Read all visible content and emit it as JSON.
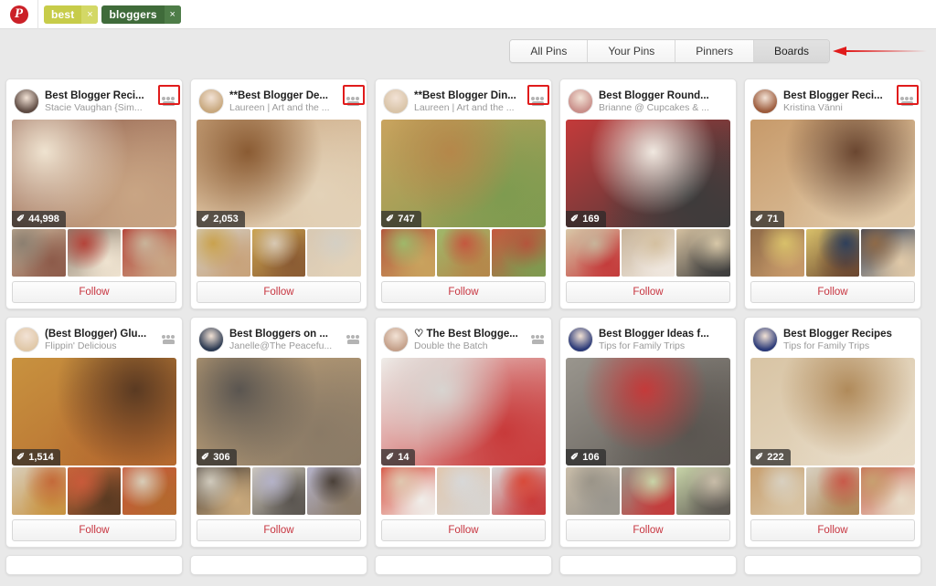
{
  "topbar": {
    "logo_icon": "pinterest-logo-icon",
    "search_tokens": [
      {
        "label": "best",
        "color": "#c7cc49",
        "remove_icon": "close-icon"
      },
      {
        "label": "bloggers",
        "color": "#3f6b3a",
        "remove_icon": "close-icon"
      }
    ]
  },
  "tabs": {
    "items": [
      {
        "label": "All Pins",
        "active": false
      },
      {
        "label": "Your Pins",
        "active": false
      },
      {
        "label": "Pinners",
        "active": false
      },
      {
        "label": "Boards",
        "active": true
      }
    ],
    "annotation_arrow_color": "#e01b1b",
    "annotation_arrow_icon": "arrow-left-icon"
  },
  "follow_label": "Follow",
  "pin_glyph": "✐",
  "highlight_color": "#e01b1b",
  "boards": [
    {
      "title": "Best Blogger Reci...",
      "owner": "Stacie Vaughan {Sim...",
      "pins": "44,998",
      "group_board": true,
      "highlighted": true,
      "avatar_color": "#5d4a42",
      "hero_colors": [
        "#8d5b4a",
        "#efe3d0",
        "#c9a584"
      ],
      "thumb_colors": [
        "#c9b49a",
        "#8c7f70",
        "#b5443a"
      ]
    },
    {
      "title": "**Best Blogger De...",
      "owner": "Laureen | Art and the ...",
      "pins": "2,053",
      "group_board": true,
      "highlighted": true,
      "avatar_color": "#c8a87e",
      "hero_colors": [
        "#c8a27a",
        "#8a5b33",
        "#e3d2b8"
      ],
      "thumb_colors": [
        "#d4cfc4",
        "#caa24e",
        "#d8c9b4"
      ]
    },
    {
      "title": "**Best Blogger Din...",
      "owner": "Laureen | Art and the ...",
      "pins": "747",
      "group_board": true,
      "highlighted": true,
      "avatar_color": "#d9c4a8",
      "hero_colors": [
        "#c9a35e",
        "#b5874a",
        "#7e9b50"
      ],
      "thumb_colors": [
        "#b4553c",
        "#9fb86a",
        "#c4583f"
      ]
    },
    {
      "title": "Best Blogger Round...",
      "owner": "Brianne @ Cupcakes & ...",
      "pins": "169",
      "group_board": false,
      "highlighted": false,
      "avatar_color": "#c98f8a",
      "hero_colors": [
        "#c43a3a",
        "#f0e8e0",
        "#3b3b3b"
      ],
      "thumb_colors": [
        "#d8c8a8",
        "#c8b49a",
        "#d4c0a0"
      ]
    },
    {
      "title": "Best Blogger Reci...",
      "owner": "Kristina Vänni",
      "pins": "71",
      "group_board": true,
      "highlighted": true,
      "avatar_color": "#9c5b3c",
      "hero_colors": [
        "#c79a6a",
        "#6a4630",
        "#e0c9a8"
      ],
      "thumb_colors": [
        "#8f6a48",
        "#d8c06a",
        "#2f3f5a"
      ]
    },
    {
      "title": "(Best Blogger) Glu...",
      "owner": "Flippin' Delicious",
      "pins": "1,514",
      "group_board": true,
      "highlighted": false,
      "avatar_color": "#e0c8a8",
      "hero_colors": [
        "#c8923f",
        "#5a3a22",
        "#b4682e"
      ],
      "thumb_colors": [
        "#d8cdb8",
        "#c46a3a",
        "#c85a3a"
      ]
    },
    {
      "title": "Best Bloggers on ...",
      "owner": "Janelle@The Peacefu...",
      "pins": "306",
      "group_board": true,
      "highlighted": false,
      "avatar_color": "#2c3a52",
      "hero_colors": [
        "#c9a97c",
        "#5a5550",
        "#8a7a66"
      ],
      "thumb_colors": [
        "#4a4038",
        "#d0cabc",
        "#b4b2c8"
      ]
    },
    {
      "title": "♡ The Best Blogge...",
      "owner": "Double the Batch",
      "pins": "14",
      "group_board": true,
      "highlighted": false,
      "avatar_color": "#c4a08a",
      "hero_colors": [
        "#f0eeea",
        "#d8d4d0",
        "#c83a3a"
      ],
      "thumb_colors": [
        "#d84a3a",
        "#e0c8b0",
        "#d8d8d8"
      ]
    },
    {
      "title": "Best Blogger Ideas f...",
      "owner": "Tips for Family Trips",
      "pins": "106",
      "group_board": false,
      "highlighted": false,
      "avatar_color": "#2b3a78",
      "hero_colors": [
        "#9a968e",
        "#c43a3a",
        "#5a5550"
      ],
      "thumb_colors": [
        "#c8bca8",
        "#9a9488",
        "#c8d4a8"
      ]
    },
    {
      "title": "Best Blogger Recipes",
      "owner": "Tips for Family Trips",
      "pins": "222",
      "group_board": false,
      "highlighted": false,
      "avatar_color": "#2b3a78",
      "hero_colors": [
        "#d8c4a4",
        "#b08a5a",
        "#e8dcc8"
      ],
      "thumb_colors": [
        "#c8a070",
        "#d8d0c0",
        "#c85a4a"
      ]
    }
  ]
}
